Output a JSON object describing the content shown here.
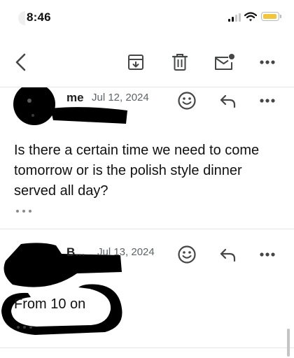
{
  "status_bar": {
    "time": "8:46"
  },
  "toolbar": {
    "icons": [
      "back-chevron-icon",
      "archive-icon",
      "trash-icon",
      "mark-unread-icon",
      "more-horizontal-icon"
    ]
  },
  "messages": [
    {
      "sender": "me",
      "date": "Jul 12, 2024",
      "body": "Is there a certain time we need to come tomorrow or is the polish style dinner served all day?",
      "actions": [
        "emoji-reaction-icon",
        "reply-icon",
        "more-horizontal-icon"
      ]
    },
    {
      "sender": "B...",
      "date": "Jul 13, 2024",
      "body": "From 10 on",
      "actions": [
        "emoji-reaction-icon",
        "reply-icon",
        "more-horizontal-icon"
      ]
    }
  ],
  "colors": {
    "text": "#1f1f1f",
    "secondary_text": "#5f6368",
    "icon": "#444746",
    "battery": "#f2c53d",
    "redaction": "#000000"
  }
}
